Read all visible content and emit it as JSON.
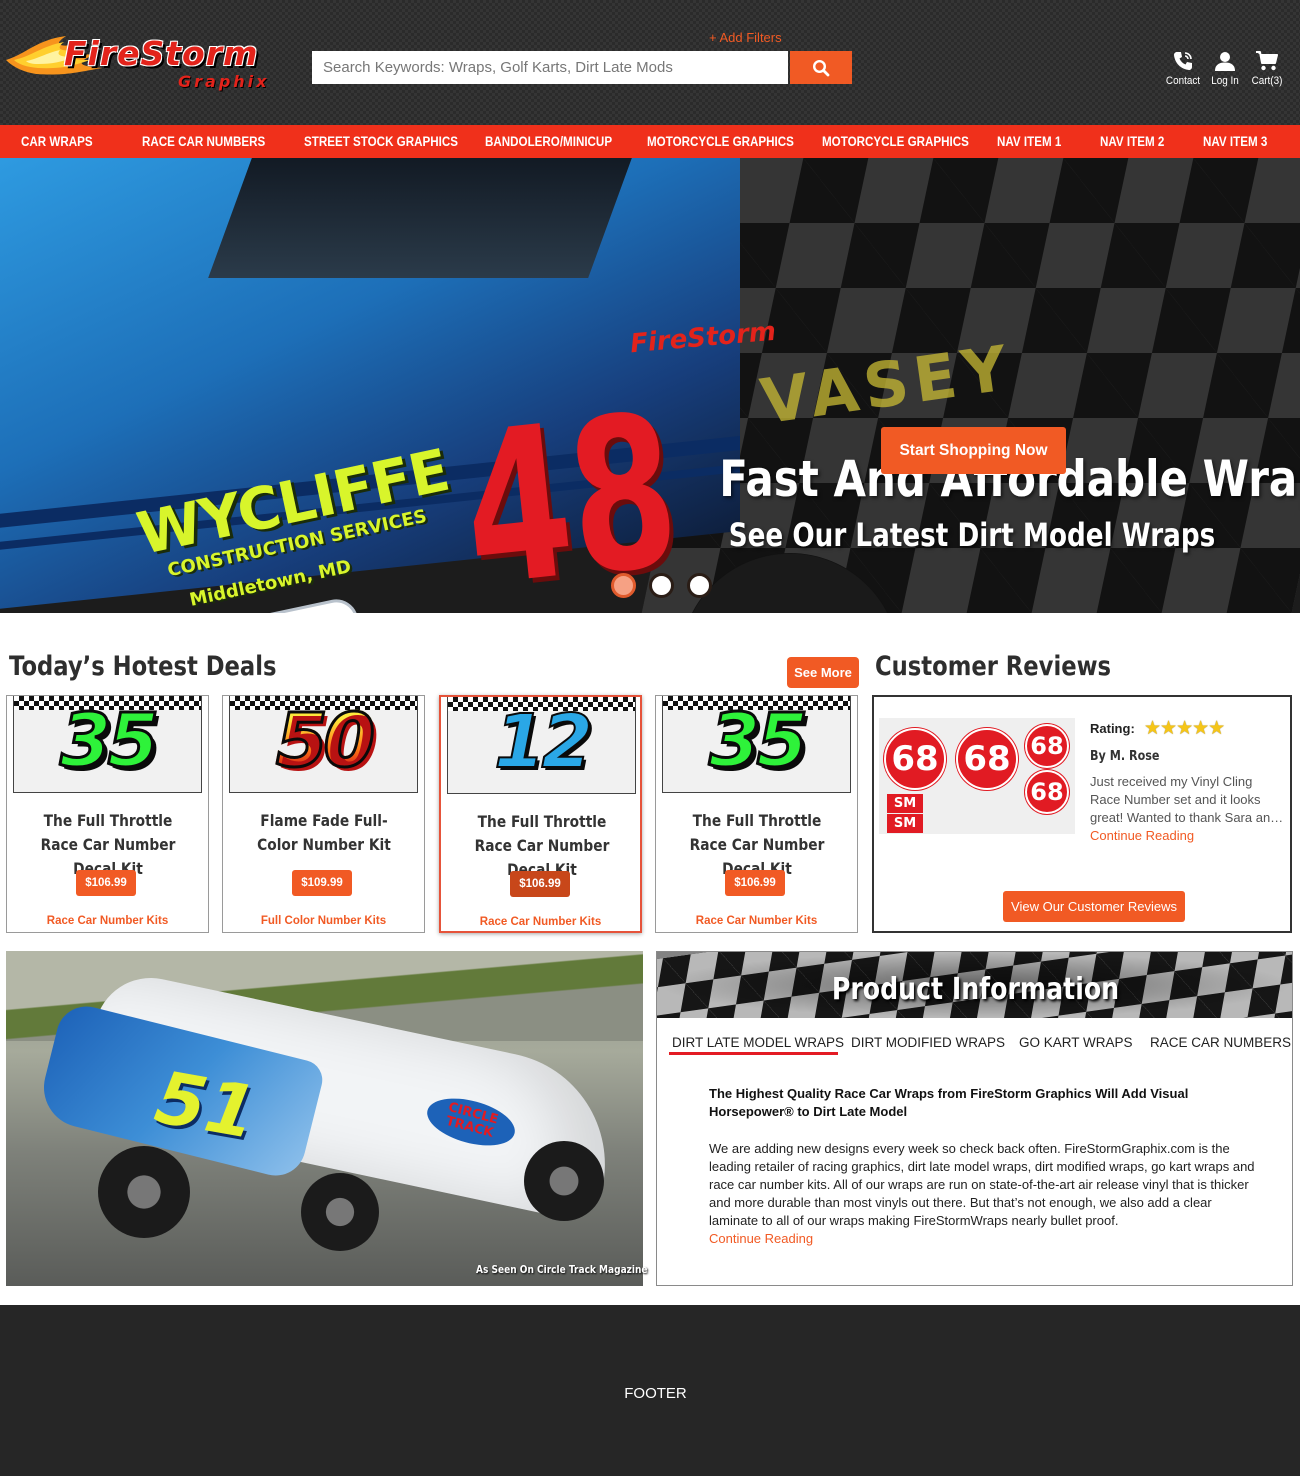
{
  "header": {
    "logo_top": "FireStorm",
    "logo_bottom": "Graphix",
    "add_filters": "+ Add Filters",
    "search_placeholder": "Search Keywords: Wraps, Golf Karts, Dirt Late Mods",
    "icons": [
      {
        "icon": "phone-icon",
        "label": "Contact"
      },
      {
        "icon": "user-icon",
        "label": "Log In"
      },
      {
        "icon": "cart-icon",
        "label": "Cart(3)"
      }
    ]
  },
  "nav": {
    "items": [
      "CAR WRAPS",
      "RACE CAR NUMBERS",
      "STREET STOCK GRAPHICS",
      "BANDOLERO/MINICUP",
      "MOTORCYCLE GRAPHICS",
      "MOTORCYCLE GRAPHICS",
      "NAV ITEM 1",
      "NAV ITEM 2",
      "NAV ITEM 3"
    ]
  },
  "hero": {
    "title": "Fast And Affordable Wraps",
    "subtitle": "See Our Latest Dirt Model Wraps",
    "cta": "Start Shopping Now",
    "slides": 3,
    "active_slide": 1,
    "car_text": {
      "sponsor": "WYCLIFFE",
      "sponsor_line": "CONSTRUCTION SERVICES",
      "town": "Middletown, MD",
      "number": "48",
      "alpha": "alpha",
      "vasey": "VASEY",
      "brand": "FireStorm"
    }
  },
  "deals": {
    "title": "Today’s Hotest Deals",
    "see_more": "See More",
    "products": [
      {
        "number": "35",
        "style": "green",
        "title": "The Full Throttle Race Car Number Decal Kit",
        "price": "$106.99",
        "category": "Race Car Number Kits"
      },
      {
        "number": "50",
        "style": "flame",
        "title": "Flame Fade Full-Color Number Kit",
        "price": "$109.99",
        "category": "Full Color Number Kits"
      },
      {
        "number": "12",
        "style": "blue",
        "title": "The Full Throttle Race Car Number Decal Kit",
        "price": "$106.99",
        "category": "Race Car Number Kits"
      },
      {
        "number": "35",
        "style": "green",
        "title": "The Full Throttle Race Car Number Decal Kit",
        "price": "$106.99",
        "category": "Race Car Number Kits"
      }
    ]
  },
  "reviews": {
    "title": "Customer Reviews",
    "rating_label": "Rating:",
    "stars": 5,
    "by": "By M. Rose",
    "text": "Just received my Vinyl Cling Race Number set and it looks great! Wanted to thank Sara an…",
    "continue": "Continue Reading",
    "button": "View Our Customer Reviews",
    "image_numbers": [
      "68",
      "68",
      "68",
      "68"
    ],
    "image_sm": [
      "SM",
      "SM"
    ]
  },
  "feature": {
    "caption": "As Seen On Circle Track Magazine",
    "car_number": "51",
    "decal": "CIRCLE TRACK"
  },
  "product_info": {
    "title": "Product Information",
    "tabs": [
      "DIRT LATE MODEL WRAPS",
      "DIRT MODIFIED WRAPS",
      "GO KART WRAPS",
      "RACE CAR NUMBERS"
    ],
    "active_tab": 0,
    "heading": "The Highest Quality Race Car Wraps from FireStorm Graphics Will Add Visual Horsepower® to Dirt Late Model",
    "body": "We are adding new designs every week so check back often. FireStormGraphix.com is the leading retailer of racing graphics, dirt late model wraps, dirt modified wraps, go kart wraps and race car number kits. All of our wraps are run on state-of-the-art air release vinyl that is thicker and more durable than most vinyls out there. But that’s not enough, we also add a clear laminate to all of our wraps making FireStormWraps nearly bullet proof.",
    "continue": "Continue Reading"
  },
  "footer": {
    "label": "FOOTER"
  },
  "colors": {
    "accent": "#f15a24",
    "nav": "#f0301b",
    "header_bg": "#2b2b2b",
    "footer_bg": "#262626"
  }
}
